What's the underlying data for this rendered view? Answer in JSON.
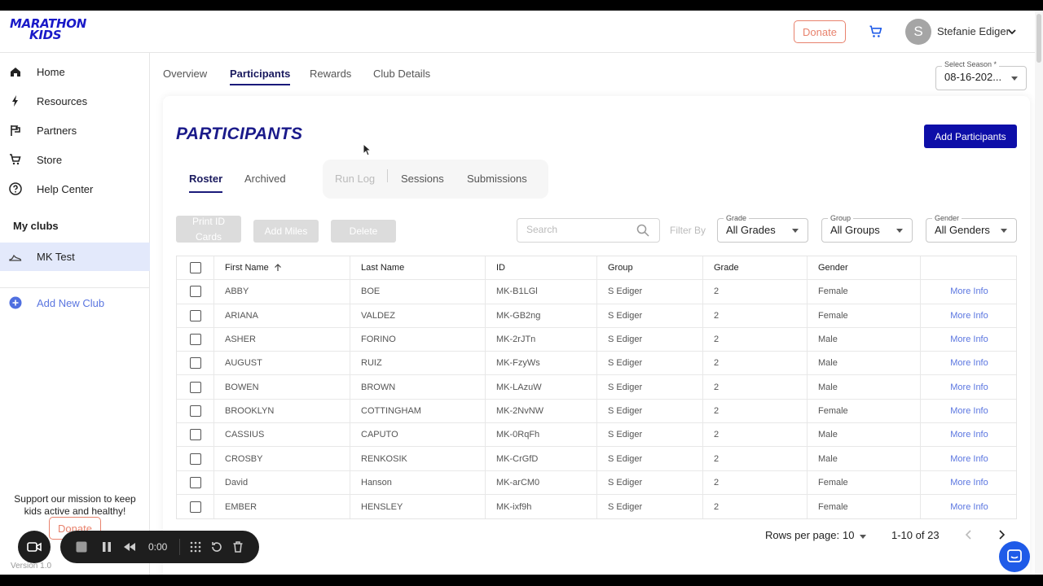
{
  "header": {
    "logo_line1": "MARATHON",
    "logo_line2": "KIDS",
    "donate_label": "Donate",
    "avatar_initial": "S",
    "user_name": "Stefanie Ediger"
  },
  "sidebar": {
    "items": [
      {
        "label": "Home",
        "icon": "home-icon"
      },
      {
        "label": "Resources",
        "icon": "bolt-icon"
      },
      {
        "label": "Partners",
        "icon": "flag-icon"
      },
      {
        "label": "Store",
        "icon": "cart-icon"
      },
      {
        "label": "Help Center",
        "icon": "help-icon"
      }
    ],
    "my_clubs_label": "My clubs",
    "club_name": "MK Test",
    "add_club_label": "Add New Club",
    "support_text": "Support our mission to keep kids active and healthy!",
    "donate_label": "Donate",
    "version": "Version 1.0"
  },
  "main_tabs": [
    "Overview",
    "Participants",
    "Rewards",
    "Club Details"
  ],
  "season": {
    "label": "Select Season *",
    "value": "08-16-202..."
  },
  "page": {
    "title": "PARTICIPANTS",
    "add_button": "Add Participants"
  },
  "sub_tabs": {
    "roster": "Roster",
    "archived": "Archived",
    "run_log": "Run Log",
    "sessions": "Sessions",
    "submissions": "Submissions"
  },
  "actions": {
    "print_id": "Print ID Cards",
    "add_miles": "Add Miles",
    "delete": "Delete"
  },
  "search": {
    "placeholder": "Search",
    "filter_by": "Filter By"
  },
  "filters": {
    "grade": {
      "label": "Grade",
      "value": "All Grades"
    },
    "group": {
      "label": "Group",
      "value": "All Groups"
    },
    "gender": {
      "label": "Gender",
      "value": "All Genders"
    }
  },
  "table": {
    "columns": [
      "First Name",
      "Last Name",
      "ID",
      "Group",
      "Grade",
      "Gender"
    ],
    "more_info": "More Info",
    "rows": [
      [
        "ABBY",
        "BOE",
        "MK-B1LGl",
        "S Ediger",
        "2",
        "Female"
      ],
      [
        "ARIANA",
        "VALDEZ",
        "MK-GB2ng",
        "S Ediger",
        "2",
        "Female"
      ],
      [
        "ASHER",
        "FORINO",
        "MK-2rJTn",
        "S Ediger",
        "2",
        "Male"
      ],
      [
        "AUGUST",
        "RUIZ",
        "MK-FzyWs",
        "S Ediger",
        "2",
        "Male"
      ],
      [
        "BOWEN",
        "BROWN",
        "MK-LAzuW",
        "S Ediger",
        "2",
        "Male"
      ],
      [
        "BROOKLYN",
        "COTTINGHAM",
        "MK-2NvNW",
        "S Ediger",
        "2",
        "Female"
      ],
      [
        "CASSIUS",
        "CAPUTO",
        "MK-0RqFh",
        "S Ediger",
        "2",
        "Male"
      ],
      [
        "CROSBY",
        "RENKOSIK",
        "MK-CrGfD",
        "S Ediger",
        "2",
        "Male"
      ],
      [
        "David",
        "Hanson",
        "MK-arCM0",
        "S Ediger",
        "2",
        "Female"
      ],
      [
        "EMBER",
        "HENSLEY",
        "MK-ixf9h",
        "S Ediger",
        "2",
        "Female"
      ]
    ]
  },
  "pagination": {
    "rows_per_page_label": "Rows per page:",
    "rows_per_page": "10",
    "range": "1-10 of 23"
  },
  "recorder": {
    "time": "0:00"
  },
  "colors": {
    "brand": "#1a1ac8",
    "primary_button": "#0d0ea8",
    "donate": "#e8826d",
    "link": "#5b76e0",
    "active_club_bg": "#e3e9fb"
  }
}
